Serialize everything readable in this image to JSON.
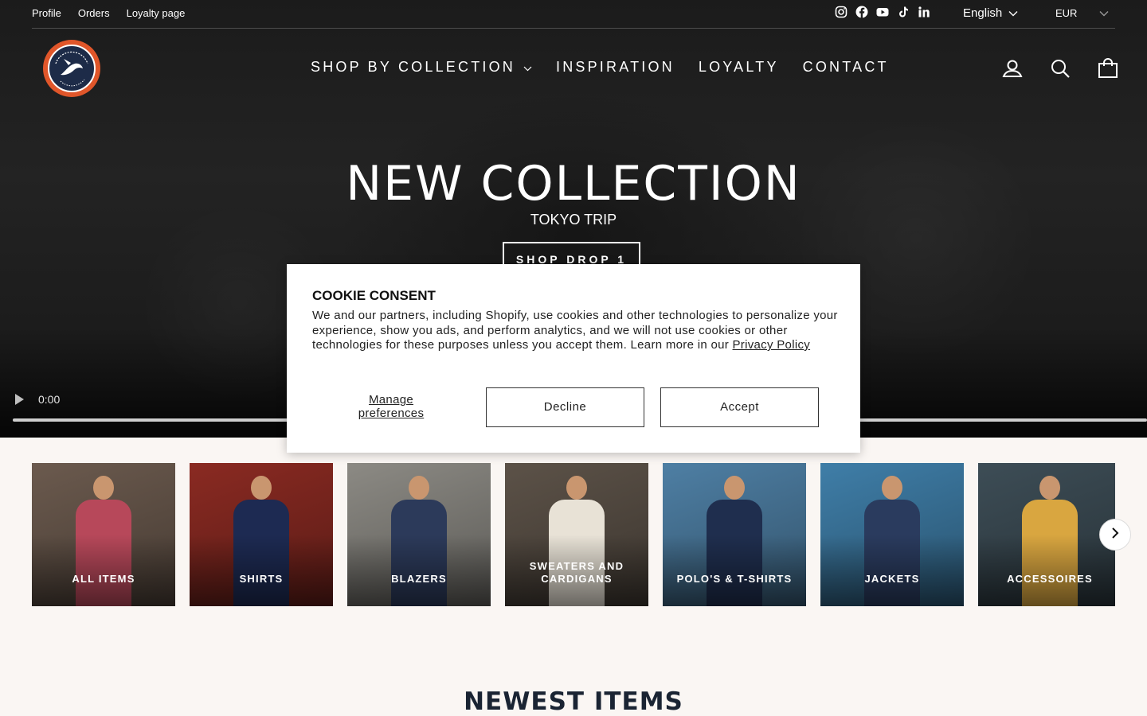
{
  "utility": {
    "links": [
      "Profile",
      "Orders",
      "Loyalty page"
    ],
    "socials": [
      "instagram-icon",
      "facebook-icon",
      "youtube-icon",
      "tiktok-icon",
      "linkedin-icon"
    ],
    "language": "English",
    "currency": "EUR"
  },
  "nav": {
    "items": [
      "SHOP BY COLLECTION",
      "INSPIRATION",
      "LOYALTY",
      "CONTACT"
    ],
    "icons": [
      "account-icon",
      "search-icon",
      "cart-icon"
    ]
  },
  "hero": {
    "title": "NEW COLLECTION",
    "subtitle": "TOKYO TRIP",
    "button": "SHOP DROP 1",
    "video_time": "0:00"
  },
  "categories": [
    {
      "label": "ALL ITEMS",
      "bg": "#6b5a4e",
      "shirt": "#b7485a"
    },
    {
      "label": "SHIRTS",
      "bg": "#8a2a22",
      "shirt": "#1d2a52"
    },
    {
      "label": "BLAZERS",
      "bg": "#8c8a84",
      "shirt": "#2c3a5a"
    },
    {
      "label": "SWEATERS AND CARDIGANS",
      "bg": "#5c5248",
      "shirt": "#e8e2d6"
    },
    {
      "label": "POLO'S & T-SHIRTS",
      "bg": "#4e7fa4",
      "shirt": "#1f2e4e"
    },
    {
      "label": "JACKETS",
      "bg": "#3f7ea8",
      "shirt": "#2a3b5e"
    },
    {
      "label": "ACCESSOIRES",
      "bg": "#3d4d56",
      "shirt": "#d9a640"
    }
  ],
  "section_title": "NEWEST ITEMS",
  "cookie": {
    "title": "COOKIE CONSENT",
    "text": "We and our partners, including Shopify, use cookies and other technologies to personalize your experience, show you ads, and perform analytics, and we will not use cookies or other technologies for these purposes unless you accept them. Learn more in our",
    "link": "Privacy Policy",
    "manage": "Manage preferences",
    "decline": "Decline",
    "accept": "Accept"
  }
}
